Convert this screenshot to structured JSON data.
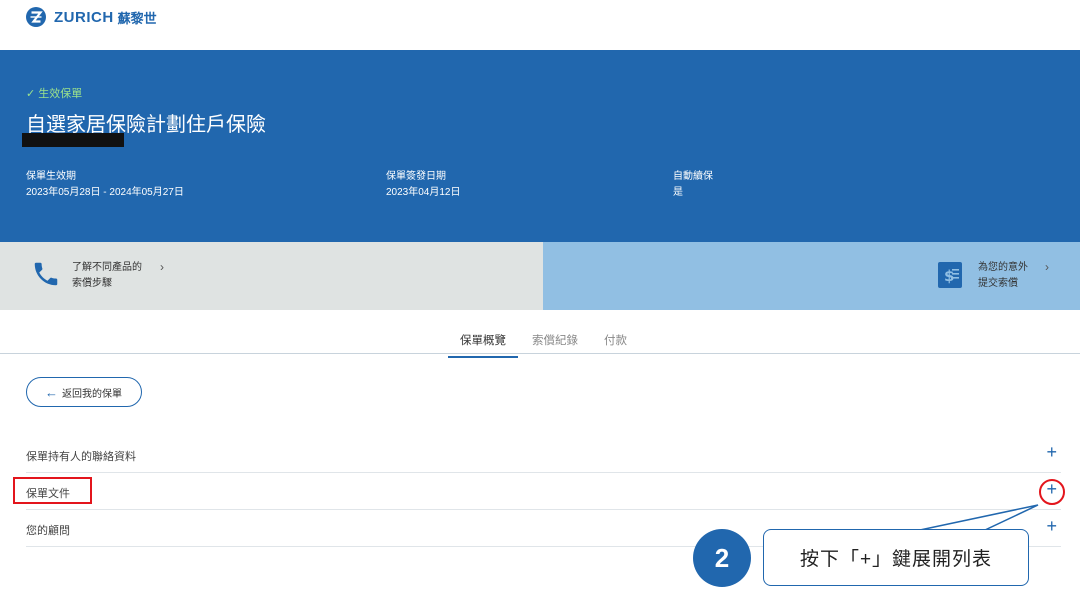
{
  "brand": {
    "name": "ZURICH",
    "sub": "蘇黎世"
  },
  "policy": {
    "status": "✓ 生效保單",
    "title": "自選家居保險計劃住戶保險",
    "meta": [
      {
        "label": "保單生效期",
        "value": "2023年05月28日 - 2024年05月27日"
      },
      {
        "label": "保單簽發日期",
        "value": "2023年04月12日"
      },
      {
        "label": "自動續保",
        "value": "是"
      }
    ]
  },
  "cards": {
    "left": {
      "line1": "了解不同產品的",
      "line2": "索償步驟"
    },
    "right": {
      "line1": "為您的意外",
      "line2": "提交索償"
    }
  },
  "tabs": [
    {
      "label": "保單概覽",
      "active": true
    },
    {
      "label": "索償紀錄",
      "active": false
    },
    {
      "label": "付款",
      "active": false
    }
  ],
  "back_button": {
    "label": "返回我的保單"
  },
  "accordion": [
    {
      "label": "保單持有人的聯絡資料",
      "icon": "+"
    },
    {
      "label": "保單文件",
      "icon": "+"
    },
    {
      "label": "您的顧問",
      "icon": "+"
    }
  ],
  "annotation": {
    "step": "2",
    "text": "按下「+」鍵展開列表"
  },
  "colors": {
    "brand_blue": "#2167ae",
    "status_green": "#9be28c",
    "highlight_red": "#e3151c"
  }
}
